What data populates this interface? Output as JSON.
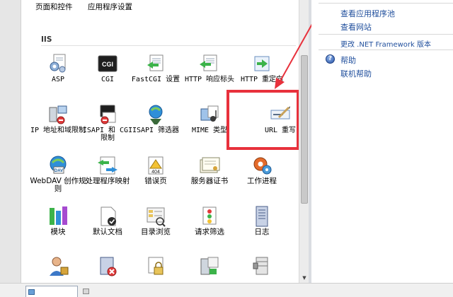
{
  "top_categories": [
    "页面和控件",
    "应用程序设置"
  ],
  "group_title": "IIS",
  "features": [
    {
      "label": "ASP"
    },
    {
      "label": "CGI"
    },
    {
      "label": "FastCGI 设置"
    },
    {
      "label": "HTTP 响应标头"
    },
    {
      "label": "HTTP 重定向"
    },
    {
      "label": "IP 地址和域限制"
    },
    {
      "label": "ISAPI 和 CGI 限制"
    },
    {
      "label": "ISAPI 筛选器"
    },
    {
      "label": "MIME 类型"
    },
    {
      "label": "URL 重写"
    },
    {
      "label": "WebDAV 创作规则"
    },
    {
      "label": "处理程序映射"
    },
    {
      "label": "错误页"
    },
    {
      "label": "服务器证书"
    },
    {
      "label": "工作进程"
    },
    {
      "label": "模块"
    },
    {
      "label": "默认文档"
    },
    {
      "label": "目录浏览"
    },
    {
      "label": "请求筛选"
    },
    {
      "label": "日志"
    }
  ],
  "actions": {
    "view_app_pools": "查看应用程序池",
    "view_sites": "查看网站",
    "change_framework": "更改 .NET Framework 版本",
    "help": "帮助",
    "online_help": "联机帮助"
  },
  "icons": {
    "help": "?",
    "cgi": "CGI",
    "error_page": "404",
    "webdav": "DAV"
  },
  "colors": {
    "highlight": "#e8313c",
    "link": "#1f4e9c"
  }
}
